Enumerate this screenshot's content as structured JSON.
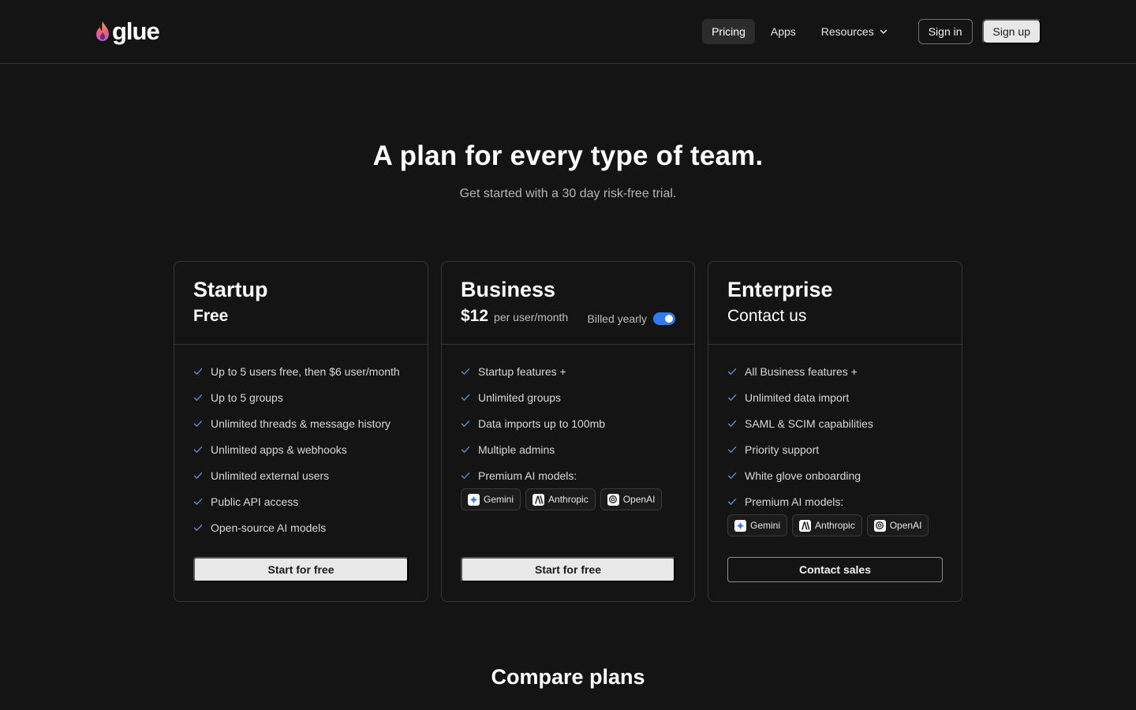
{
  "header": {
    "logo_text": "glue",
    "nav": [
      {
        "label": "Pricing",
        "active": true
      },
      {
        "label": "Apps",
        "active": false
      },
      {
        "label": "Resources",
        "active": false
      }
    ],
    "sign_in": "Sign in",
    "sign_up": "Sign up"
  },
  "hero": {
    "title": "A plan for every type of team.",
    "subtitle": "Get started with a 30 day risk-free trial."
  },
  "plans": [
    {
      "name": "Startup",
      "price": "Free",
      "features": [
        "Up to 5 users free, then $6 user/month",
        "Up to 5 groups",
        "Unlimited threads & message history",
        "Unlimited apps & webhooks",
        "Unlimited external users",
        "Public API access",
        "Open-source AI models"
      ],
      "cta": "Start for free"
    },
    {
      "name": "Business",
      "price": "$12",
      "price_unit": "per user/month",
      "billing_label": "Billed yearly",
      "billing_yearly": true,
      "features": [
        "Startup features +",
        "Unlimited groups",
        "Data imports up to 100mb",
        "Multiple admins",
        "Premium AI models:"
      ],
      "models": [
        "Gemini",
        "Anthropic",
        "OpenAI"
      ],
      "cta": "Start for free"
    },
    {
      "name": "Enterprise",
      "price": "Contact us",
      "features": [
        "All Business features +",
        "Unlimited data import",
        "SAML & SCIM capabilities",
        "Priority support",
        "White glove onboarding",
        "Premium AI models:"
      ],
      "models": [
        "Gemini",
        "Anthropic",
        "OpenAI"
      ],
      "cta": "Contact sales"
    }
  ],
  "compare": {
    "title": "Compare plans"
  },
  "colors": {
    "background": "#141414",
    "accent_toggle": "#2f7bf5",
    "check": "#5b8dd9"
  }
}
